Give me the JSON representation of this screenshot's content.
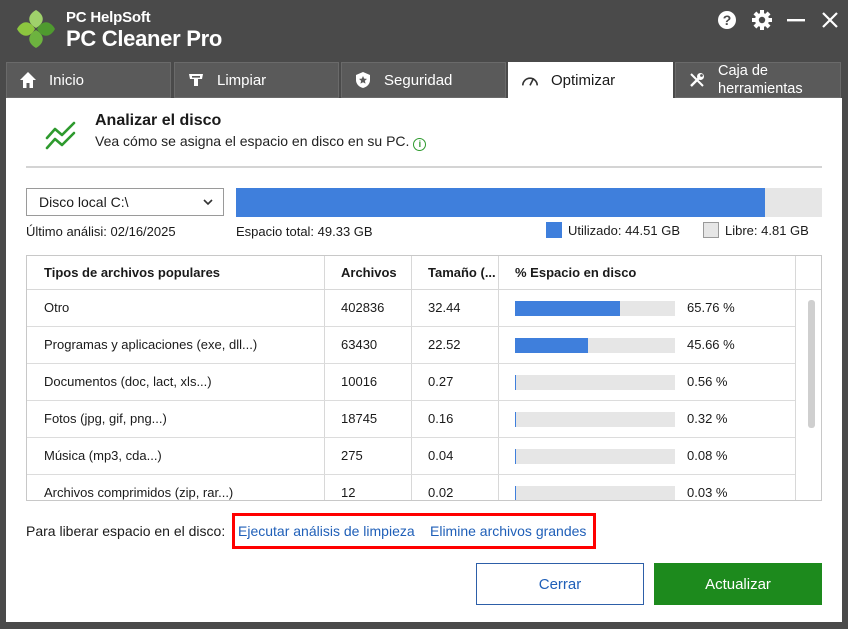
{
  "app": {
    "brand_top": "PC HelpSoft",
    "brand_main": "PC Cleaner Pro",
    "icons": [
      "help-icon",
      "gear-icon",
      "minimize-icon",
      "close-icon"
    ]
  },
  "tabs": [
    {
      "label": "Inicio",
      "icon": "home-icon"
    },
    {
      "label": "Limpiar",
      "icon": "broom-icon"
    },
    {
      "label": "Seguridad",
      "icon": "shield-icon"
    },
    {
      "label": "Optimizar",
      "icon": "gauge-icon",
      "active": true
    },
    {
      "label_line1": "Caja de",
      "label_line2": "herramientas",
      "icon": "tools-icon"
    }
  ],
  "header": {
    "title": "Analizar el disco",
    "subtitle": "Vea cómo se asigna el espacio en disco en su PC.",
    "icon": "chart-line-icon"
  },
  "disk": {
    "selected": "Disco local C:\\",
    "last_scan": "Último análisi: 02/16/2025",
    "total": "Espacio total: 49.33 GB",
    "used_label": "Utilizado: 44.51 GB",
    "free_label": "Libre: 4.81 GB",
    "used_fraction": 0.902
  },
  "table": {
    "columns": [
      "Tipos de archivos populares",
      "Archivos",
      "Tamaño (...",
      "% Espacio en disco"
    ],
    "rows": [
      {
        "type": "Otro",
        "files": "402836",
        "size": "32.44",
        "pct": "65.76 %",
        "fraction": 0.6576
      },
      {
        "type": "Programas y aplicaciones (exe, dll...)",
        "files": "63430",
        "size": "22.52",
        "pct": "45.66 %",
        "fraction": 0.4566
      },
      {
        "type": "Documentos (doc, lact, xls...)",
        "files": "10016",
        "size": "0.27",
        "pct": "0.56 %",
        "fraction": 0.0056
      },
      {
        "type": "Fotos (jpg, gif, png...)",
        "files": "18745",
        "size": "0.16",
        "pct": "0.32 %",
        "fraction": 0.0032
      },
      {
        "type": "Música (mp3, cda...)",
        "files": "275",
        "size": "0.04",
        "pct": "0.08 %",
        "fraction": 0.0008
      },
      {
        "type": "Archivos comprimidos (zip, rar...)",
        "files": "12",
        "size": "0.02",
        "pct": "0.03 %",
        "fraction": 0.0003
      }
    ]
  },
  "footer": {
    "label": "Para liberar espacio en el disco:",
    "link1": "Ejecutar análisis de limpieza",
    "link2": "Elimine archivos grandes",
    "close": "Cerrar",
    "update": "Actualizar"
  },
  "colors": {
    "accent": "#3f7fdc",
    "green": "#1d8a1d",
    "chrome": "#4a4a4a",
    "highlight": "#ff0000"
  }
}
